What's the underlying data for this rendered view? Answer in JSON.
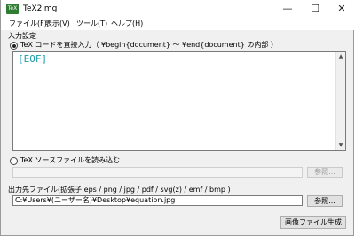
{
  "window": {
    "title": "TeX2img",
    "icon_label": "TeX",
    "minimize_glyph": "—",
    "maximize_glyph": "☐",
    "close_glyph": "✕"
  },
  "menu": {
    "items": [
      {
        "label": "ファイル(F)"
      },
      {
        "label": "表示(V)"
      },
      {
        "label": "ツール(T)"
      },
      {
        "label": "ヘルプ(H)"
      }
    ]
  },
  "input_section": {
    "heading": "入力設定",
    "direct_input_label": "TeX コードを直接入力（ ¥begin{document} ～ ¥end{document} の内部 ）",
    "direct_input_selected": true,
    "editor_text": "[EOF]",
    "source_file_label": "TeX ソースファイルを読み込む",
    "source_file_selected": false,
    "source_file_value": "",
    "browse_label": "参照..."
  },
  "output_section": {
    "label": "出力先ファイル(拡張子 eps / png / jpg / pdf / svg(z) / emf / bmp )",
    "path": "C:¥Users¥(ユーザー名)¥Desktop¥equation.jpg",
    "browse_label": "参照...",
    "generate_label": "画像ファイル生成"
  },
  "colors": {
    "eof_text": "#1a9aa8",
    "app_icon": "#2e7d32",
    "window_bg": "#f0f0f0"
  }
}
